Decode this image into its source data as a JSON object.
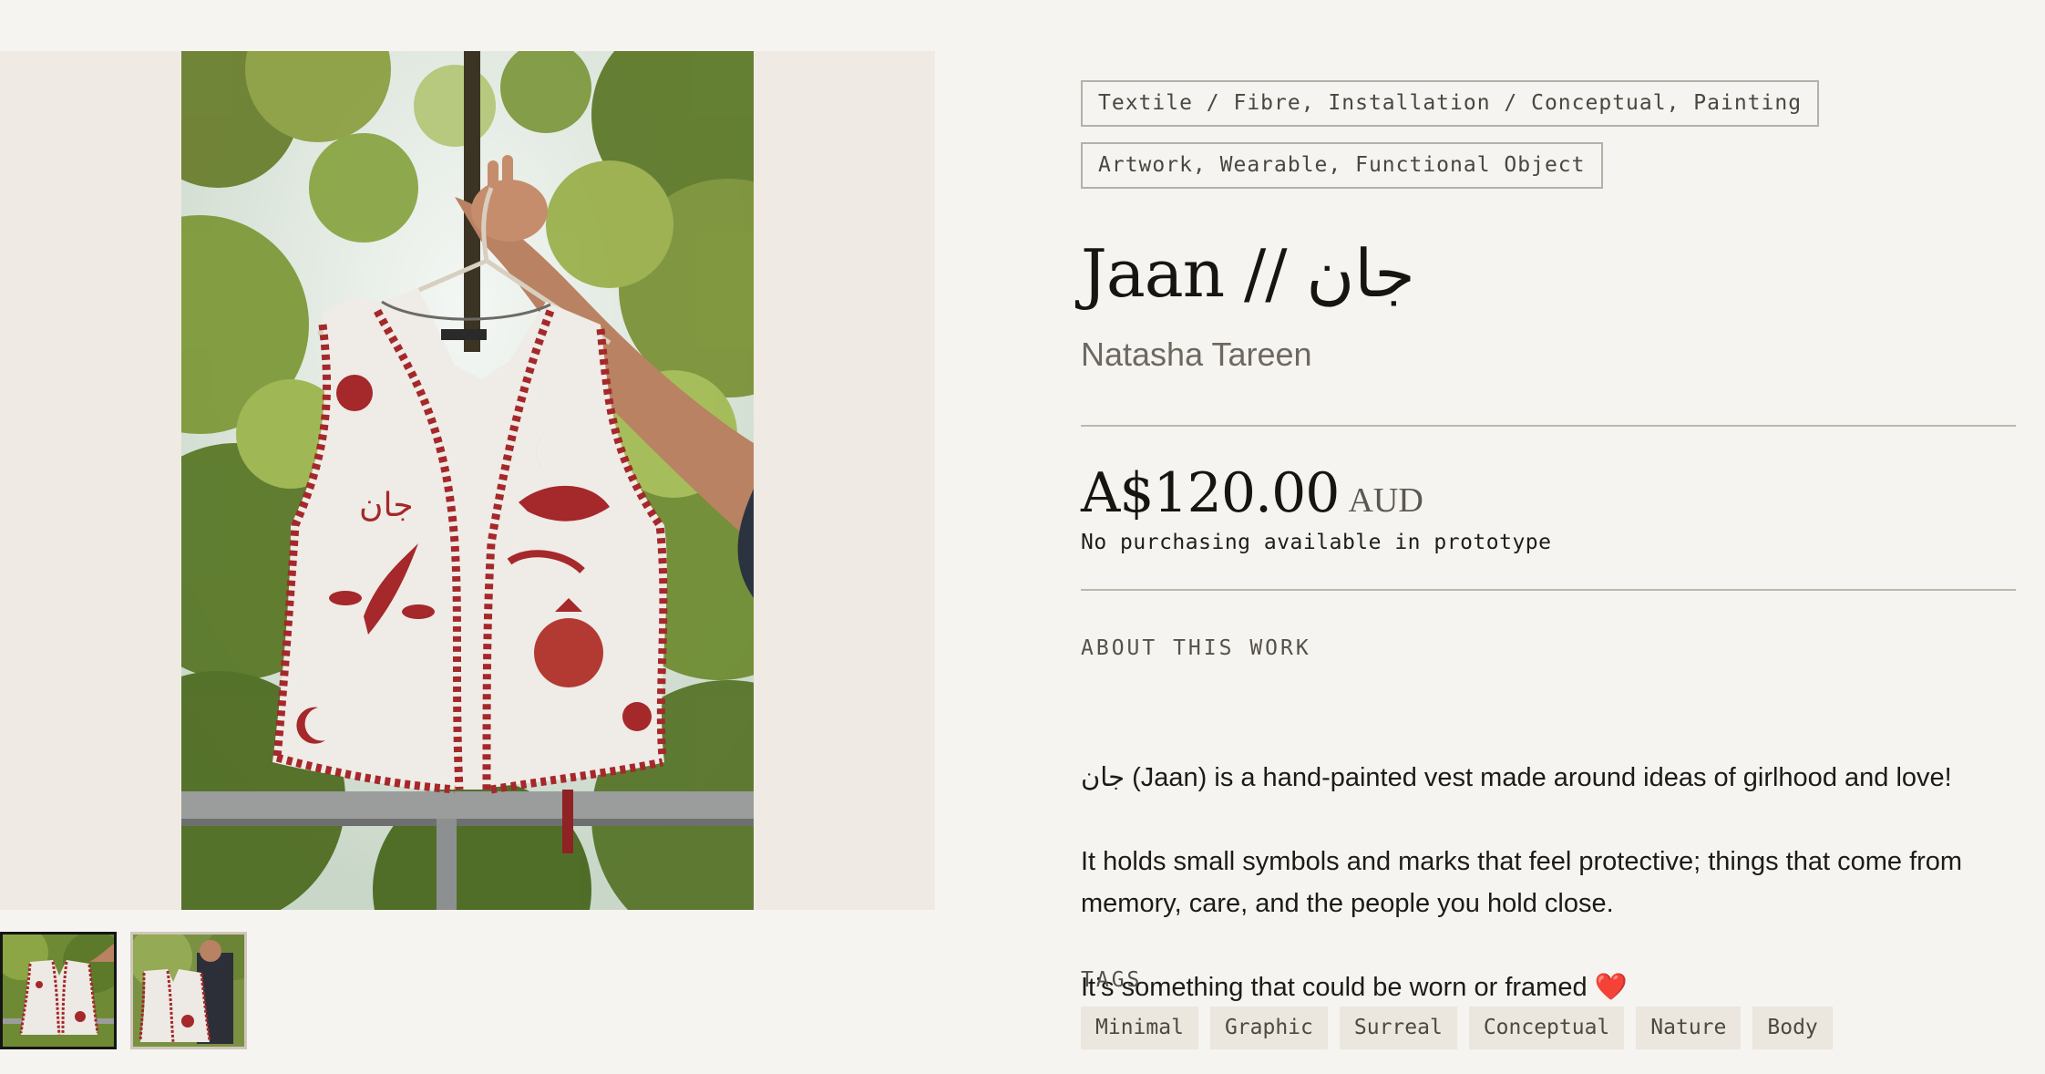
{
  "artwork": {
    "categories": [
      "Textile / Fibre, Installation / Conceptual, Painting",
      "Artwork, Wearable, Functional Object"
    ],
    "title": "Jaan // جان",
    "artist": "Natasha Tareen",
    "price": "A$120.00",
    "currency": "AUD",
    "price_note": "No purchasing available in prototype",
    "about_label": "ABOUT THIS WORK",
    "description": [
      "جان (Jaan) is a hand-painted vest made around ideas of girlhood and love!",
      "It holds small symbols and marks that feel protective; things that come from memory, care, and the people you hold close.",
      "It’s something that could be worn or framed ❤️"
    ],
    "tags_label": "TAGS",
    "tags": [
      "Minimal",
      "Graphic",
      "Surreal",
      "Conceptual",
      "Nature",
      "Body"
    ]
  },
  "gallery": {
    "thumbnails": [
      {
        "selected": true
      },
      {
        "selected": false
      }
    ]
  },
  "colors": {
    "page_background": "#f6f4f0",
    "gallery_background": "#efeae3",
    "vest_paint": "#a5282a",
    "tag_background": "#ebe6de"
  }
}
